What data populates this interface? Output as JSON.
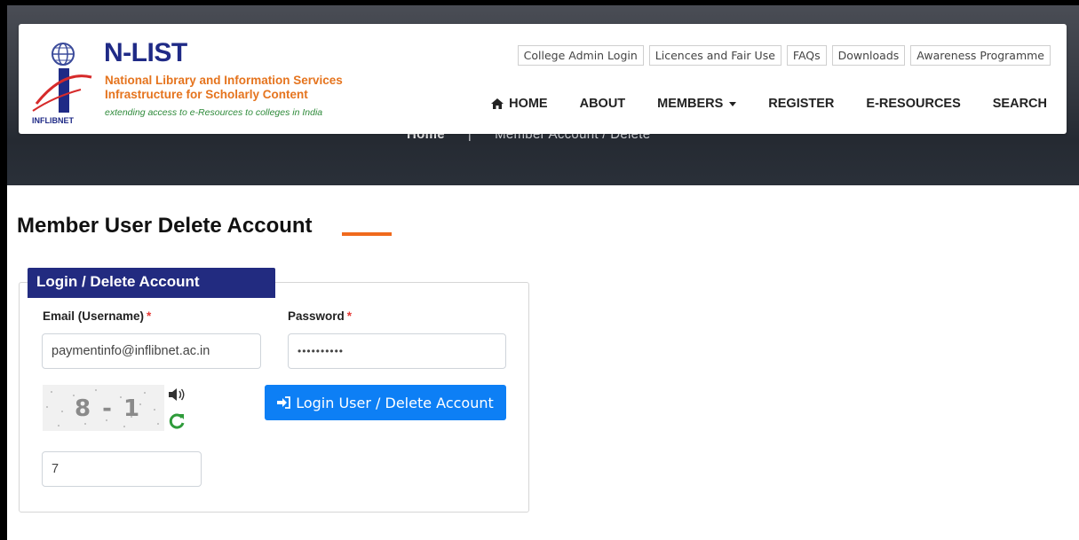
{
  "brand": {
    "title": "N-LIST",
    "line1": "National Library and Information Services",
    "line2": "Infrastructure for Scholarly Content",
    "tagline": "extending access to e-Resources to colleges in India",
    "logo_text": "INFLIBNET"
  },
  "toplinks": [
    "College Admin Login",
    "Licences and Fair Use",
    "FAQs",
    "Downloads",
    "Awareness Programme"
  ],
  "nav": {
    "home": "HOME",
    "about": "ABOUT",
    "members": "MEMBERS",
    "register": "REGISTER",
    "eresources": "E-RESOURCES",
    "search": "SEARCH"
  },
  "breadcrumb": {
    "home": "Home",
    "separator": "|",
    "current": "Member Account / Delete"
  },
  "page": {
    "title": "Member User Delete Account"
  },
  "form": {
    "tab_label": "Login / Delete Account",
    "email_label": "Email (Username)",
    "password_label": "Password",
    "required_mark": "*",
    "email_value": "paymentinfo@inflibnet.ac.in",
    "password_value": "••••••••••",
    "captcha_text": "8 - 1",
    "captcha_answer": "7",
    "submit_label": "Login User / Delete Account"
  },
  "colors": {
    "brand_blue": "#1f2a86",
    "accent_orange": "#f06a1d",
    "button_blue": "#0d7ff5",
    "tab_navy": "#222b80"
  },
  "icons": [
    "home-icon",
    "caret-down-icon",
    "speaker-icon",
    "refresh-icon",
    "sign-in-icon"
  ]
}
